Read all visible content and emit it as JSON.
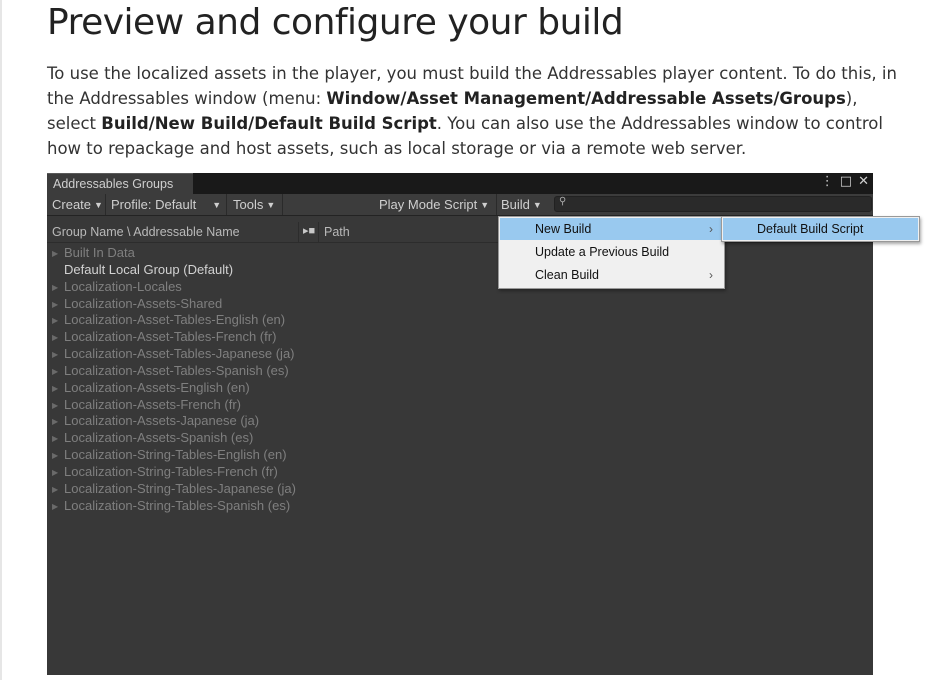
{
  "page": {
    "title": "Preview and configure your build",
    "intro": [
      {
        "text": "To use the localized assets in the player, you must build the Addressables player content. To do this, in the Addressables window (menu: ",
        "bold": false
      },
      {
        "text": "Window/Asset Management/Addressable Assets/Groups",
        "bold": true
      },
      {
        "text": "), select ",
        "bold": false
      },
      {
        "text": "Build/New Build/Default Build Script",
        "bold": true
      },
      {
        "text": ". You can also use the Addressables window to control how to repackage and host assets, such as local storage or via a remote web server.",
        "bold": false
      }
    ]
  },
  "window": {
    "tab_title": "Addressables Groups",
    "icons": [
      "more-vertical-icon",
      "maximize-icon",
      "close-icon"
    ],
    "toolbar": {
      "create": "Create",
      "profile": "Profile: Default",
      "tools": "Tools",
      "play_mode_script": "Play Mode Script",
      "build": "Build",
      "search_placeholder": ""
    },
    "columns": {
      "name": "Group Name \\ Addressable Name",
      "path": "Path"
    },
    "groups": [
      {
        "label": "Built In Data",
        "expandable": true,
        "dim": true
      },
      {
        "label": "Default Local Group (Default)",
        "expandable": false,
        "dim": false
      },
      {
        "label": "Localization-Locales",
        "expandable": true,
        "dim": true
      },
      {
        "label": "Localization-Assets-Shared",
        "expandable": true,
        "dim": true
      },
      {
        "label": "Localization-Asset-Tables-English (en)",
        "expandable": true,
        "dim": true
      },
      {
        "label": "Localization-Asset-Tables-French (fr)",
        "expandable": true,
        "dim": true
      },
      {
        "label": "Localization-Asset-Tables-Japanese (ja)",
        "expandable": true,
        "dim": true
      },
      {
        "label": "Localization-Asset-Tables-Spanish (es)",
        "expandable": true,
        "dim": true
      },
      {
        "label": "Localization-Assets-English (en)",
        "expandable": true,
        "dim": true
      },
      {
        "label": "Localization-Assets-French (fr)",
        "expandable": true,
        "dim": true
      },
      {
        "label": "Localization-Assets-Japanese (ja)",
        "expandable": true,
        "dim": true
      },
      {
        "label": "Localization-Assets-Spanish (es)",
        "expandable": true,
        "dim": true
      },
      {
        "label": "Localization-String-Tables-English (en)",
        "expandable": true,
        "dim": true
      },
      {
        "label": "Localization-String-Tables-French (fr)",
        "expandable": true,
        "dim": true
      },
      {
        "label": "Localization-String-Tables-Japanese (ja)",
        "expandable": true,
        "dim": true
      },
      {
        "label": "Localization-String-Tables-Spanish (es)",
        "expandable": true,
        "dim": true
      }
    ]
  },
  "build_menu": {
    "items": [
      {
        "label": "New Build",
        "has_submenu": true,
        "highlighted": true
      },
      {
        "label": "Update a Previous Build",
        "has_submenu": false,
        "highlighted": false
      },
      {
        "label": "Clean Build",
        "has_submenu": true,
        "highlighted": false
      }
    ],
    "submenu": {
      "label": "Default Build Script",
      "highlighted": true
    }
  },
  "colors": {
    "menu_highlight": "#99c9ef",
    "window_bg": "#383838",
    "toolbar_bg": "#3c3c3c"
  }
}
